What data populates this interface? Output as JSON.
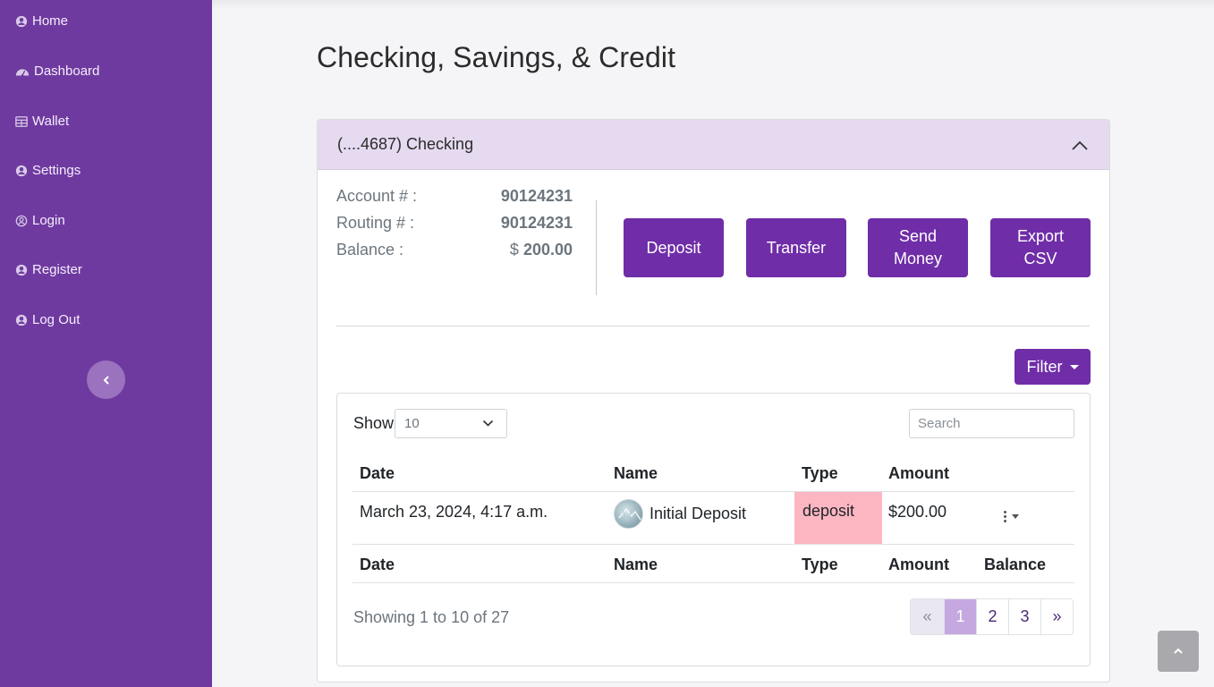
{
  "sidebar": {
    "items": [
      {
        "label": "Home",
        "icon": "user-circle-icon"
      },
      {
        "label": "Dashboard",
        "icon": "gauge-icon"
      },
      {
        "label": "Wallet",
        "icon": "table-icon"
      },
      {
        "label": "Settings",
        "icon": "user-circle-icon"
      },
      {
        "label": "Login",
        "icon": "user-circle-outline-icon"
      },
      {
        "label": "Register",
        "icon": "user-circle-icon"
      },
      {
        "label": "Log Out",
        "icon": "user-circle-icon"
      }
    ],
    "collapse_icon": "chevron-left-icon"
  },
  "page": {
    "title": "Checking, Savings, & Credit"
  },
  "account": {
    "header": "(....4687) Checking",
    "account_label": "Account # :",
    "account_number": "90124231",
    "routing_label": "Routing # :",
    "routing_number": "90124231",
    "balance_label": "Balance :",
    "balance_currency": "$",
    "balance_value": "200.00"
  },
  "actions": {
    "deposit": "Deposit",
    "transfer": "Transfer",
    "send_money": "Send Money",
    "export_csv": "Export CSV"
  },
  "filter": {
    "label": "Filter"
  },
  "table": {
    "show_label": "Show",
    "page_size": "10",
    "search_placeholder": "Search",
    "headers": {
      "date": "Date",
      "name": "Name",
      "type": "Type",
      "amount": "Amount"
    },
    "rows": [
      {
        "date": "March 23, 2024, 4:17 a.m.",
        "name": "Initial Deposit",
        "type": "deposit",
        "amount": "$200.00"
      }
    ],
    "footer_headers": {
      "date": "Date",
      "name": "Name",
      "type": "Type",
      "amount": "Amount",
      "balance": "Balance"
    },
    "showing": "Showing 1 to 10 of 27",
    "pagination": {
      "prev": "«",
      "pages": [
        "1",
        "2",
        "3"
      ],
      "next": "»",
      "active": "1"
    }
  },
  "colors": {
    "sidebar": "#6f3aa0",
    "primary_button": "#6f2da8",
    "card_header": "#e5daf0",
    "deposit_badge": "#fcb6c2"
  }
}
